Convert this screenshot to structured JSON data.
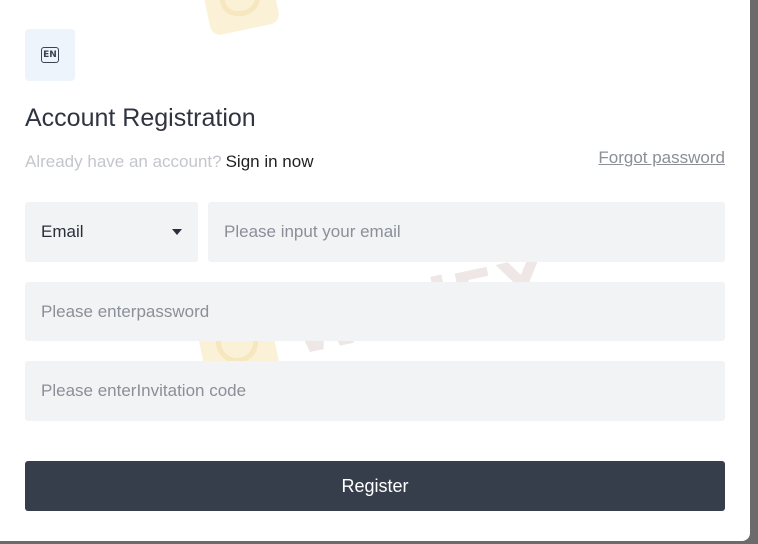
{
  "lang_button": {
    "label": "EN",
    "icon": "language-en-icon"
  },
  "title": "Account Registration",
  "signin_prompt": {
    "question": "Already have an account?",
    "link": "Sign in now"
  },
  "forgot_link": "Forgot password",
  "account_type": {
    "selected": "Email",
    "icon": "caret-down-icon"
  },
  "email_field": {
    "placeholder": "Please input your email",
    "value": ""
  },
  "password_field": {
    "placeholder": "Please enterpassword",
    "value": ""
  },
  "invitation_field": {
    "placeholder": "Please enterInvitation code",
    "value": ""
  },
  "register_button": "Register",
  "watermark": {
    "text": "WikiFX"
  },
  "colors": {
    "primary_button": "#373e4b",
    "input_bg": "#f2f3f5",
    "lang_bg": "#eef4fb",
    "muted_text": "#c3c6cc",
    "overlay": "#6b6b6b"
  }
}
